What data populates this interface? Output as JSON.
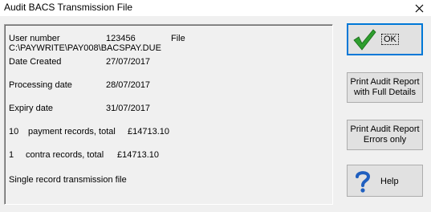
{
  "window": {
    "title": "Audit BACS Transmission File",
    "close_symbol": "✕"
  },
  "info": {
    "user_number_label": "User number",
    "user_number_value": "123456",
    "file_label": "File",
    "file_path": "C:\\PAYWRITE\\PAY008\\BACSPAY.DUE",
    "date_created_label": "Date Created",
    "date_created_value": "27/07/2017",
    "processing_date_label": "Processing date",
    "processing_date_value": "28/07/2017",
    "expiry_date_label": "Expiry date",
    "expiry_date_value": "31/07/2017",
    "payment_count": "10",
    "payment_text": "payment records,  total",
    "payment_total": "£14713.10",
    "contra_count": "1",
    "contra_text": "contra records,   total",
    "contra_total": "£14713.10",
    "footer_note": "Single record transmission file"
  },
  "buttons": {
    "ok_label": "OK",
    "full_line1": "Print Audit Report",
    "full_line2": "with Full Details",
    "errors_line1": "Print Audit Report",
    "errors_line2": "Errors only",
    "help_label": "Help"
  },
  "icons": {
    "ok": "check-mark-icon",
    "help": "question-mark-icon",
    "close": "close-icon"
  },
  "colors": {
    "check_green": "#2e9e2e",
    "help_blue": "#1f5fbf",
    "focus_border": "#0078d7"
  }
}
